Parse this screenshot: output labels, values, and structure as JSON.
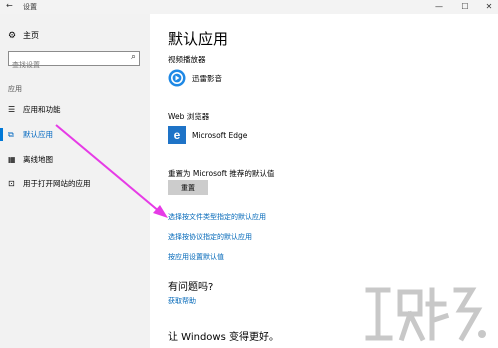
{
  "window": {
    "title": "设置",
    "back_glyph": "←",
    "minimize_glyph": "—",
    "maximize_glyph": "☐",
    "close_glyph": "✕"
  },
  "sidebar": {
    "home_label": "主页",
    "search_placeholder": "查找设置",
    "section_label": "应用",
    "items": [
      {
        "label": "应用和功能",
        "icon": "list-icon",
        "active": false
      },
      {
        "label": "默认应用",
        "icon": "default-apps-icon",
        "active": true
      },
      {
        "label": "离线地图",
        "icon": "map-icon",
        "active": false
      },
      {
        "label": "用于打开网站的应用",
        "icon": "web-app-icon",
        "active": false
      }
    ]
  },
  "main": {
    "title": "默认应用",
    "video_player": {
      "label": "视频播放器",
      "app_name": "迅雷影音",
      "icon": "xunlei-icon"
    },
    "web_browser": {
      "label": "Web 浏览器",
      "app_name": "Microsoft Edge",
      "icon": "edge-icon"
    },
    "reset_label": "重置为 Microsoft 推荐的默认值",
    "reset_button": "重置",
    "links": [
      "选择按文件类型指定的默认应用",
      "选择按协议指定的默认应用",
      "按应用设置默认值"
    ],
    "question_heading": "有问题吗?",
    "help_link": "获取帮助",
    "improve_heading": "让 Windows 变得更好。"
  },
  "colors": {
    "accent": "#0078d7",
    "link": "#0067b8",
    "annotation_arrow": "#e63be6"
  }
}
